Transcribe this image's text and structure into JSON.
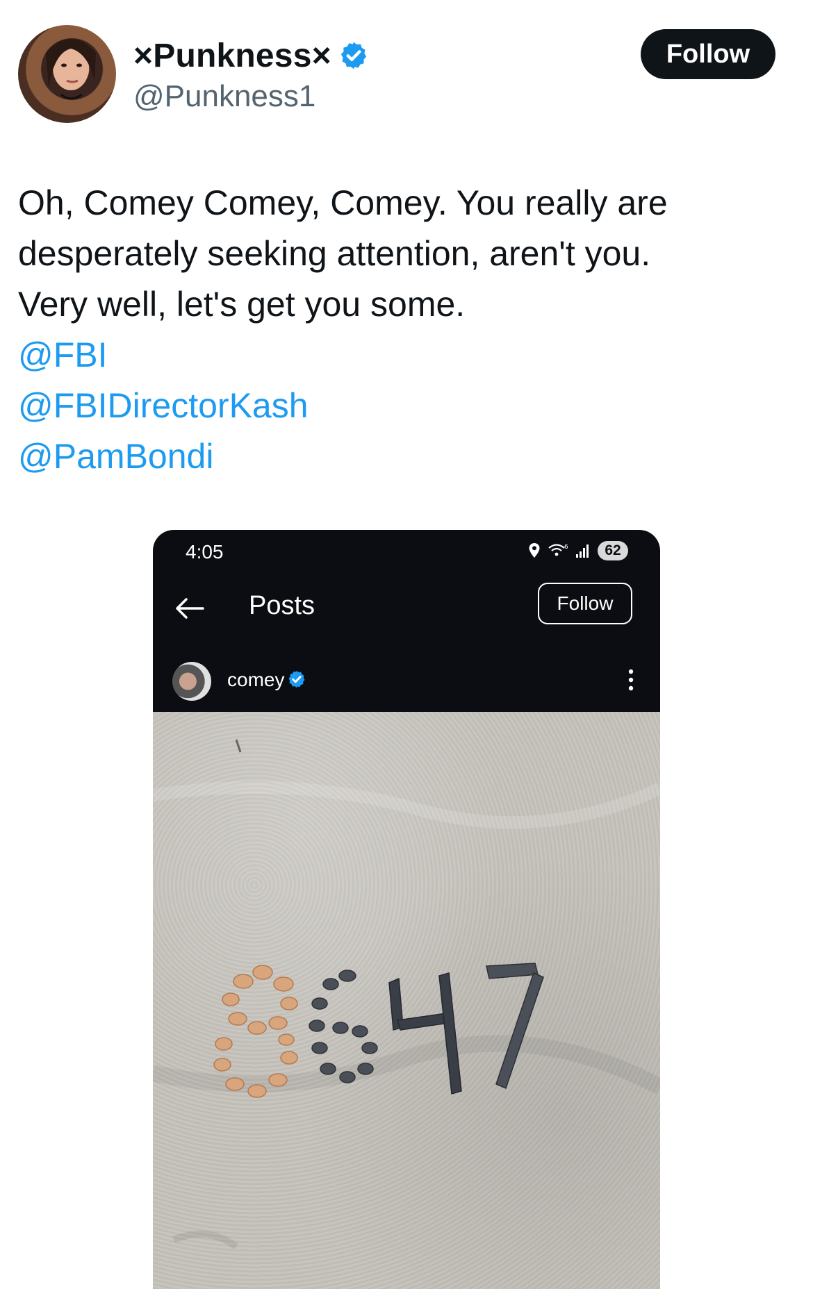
{
  "tweet": {
    "author": {
      "display_name": "×Punkness×",
      "handle": "@Punkness1",
      "verified": true
    },
    "follow_label": "Follow",
    "text_lines": [
      "Oh, Comey Comey, Comey. You really are",
      "desperately seeking attention, aren't you.",
      "Very well, let's get you some."
    ],
    "mentions": [
      "@FBI",
      "@FBIDirectorKash",
      "@PamBondi"
    ]
  },
  "embedded_screenshot": {
    "status_bar": {
      "time": "4:05",
      "battery": "62"
    },
    "nav": {
      "title": "Posts",
      "follow_label": "Follow"
    },
    "post": {
      "username": "comey",
      "verified": true
    },
    "photo_text": "8647"
  },
  "colors": {
    "link": "#1d9bf0",
    "verified": "#1d9bf0",
    "follow_bg": "#0f1419",
    "dark_ui": "#0b0d12"
  }
}
